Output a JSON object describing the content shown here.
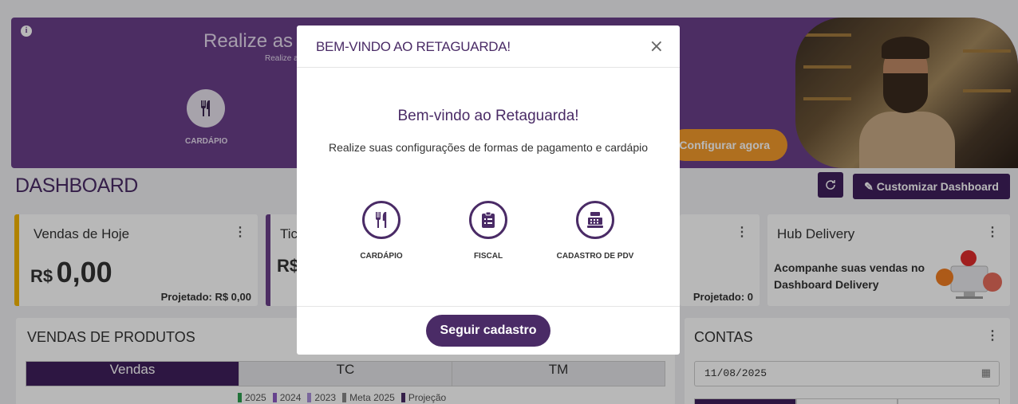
{
  "banner": {
    "title": "Realize as co",
    "subtitle": "Realize a",
    "menu_label": "CARDÁPIO",
    "configure_button": "Configurar agora"
  },
  "dashboard": {
    "title": "DASHBOARD",
    "customize_button": "Customizar Dashboard"
  },
  "cards": {
    "sales_today": {
      "title": "Vendas de Hoje",
      "currency": "R$",
      "value": "0,00",
      "projected": "Projetado: R$ 0,00"
    },
    "ticket": {
      "title": "Tic",
      "currency": "R$"
    },
    "third": {
      "projected": "Projetado: 0"
    },
    "hub": {
      "title": "Hub Delivery",
      "text": "Acompanhe suas vendas no Dashboard Delivery"
    }
  },
  "product_sales": {
    "title": "VENDAS DE PRODUTOS",
    "tabs": [
      "Vendas",
      "TC",
      "TM"
    ],
    "legend": [
      {
        "label": "2025",
        "color": "#2e9e4f"
      },
      {
        "label": "2024",
        "color": "#8e5cc4"
      },
      {
        "label": "2023",
        "color": "#a98fd8"
      },
      {
        "label": "Meta 2025",
        "color": "#888888"
      },
      {
        "label": "Projeção",
        "color": "#4a2b66"
      }
    ]
  },
  "accounts": {
    "title": "CONTAS",
    "date": "11/08/2025"
  },
  "modal": {
    "title": "BEM-VINDO AO RETAGUARDA!",
    "heading": "Bem-vindo ao Retaguarda!",
    "description": "Realize suas configurações de formas de pagamento e cardápio",
    "options": [
      "CARDÁPIO",
      "FISCAL",
      "CADASTRO DE PDV"
    ],
    "continue_button": "Seguir cadastro"
  },
  "colors": {
    "brand": "#4a2b66",
    "banner": "#6a3f8a",
    "accent": "#f39a2c",
    "overlay": "rgba(0,0,0,0.28)"
  },
  "icons": [
    "info-icon",
    "cutlery-icon",
    "refresh-icon",
    "edit-icon",
    "kebab-icon",
    "calendar-icon",
    "close-icon",
    "clipboard-icon",
    "cash-register-icon"
  ]
}
